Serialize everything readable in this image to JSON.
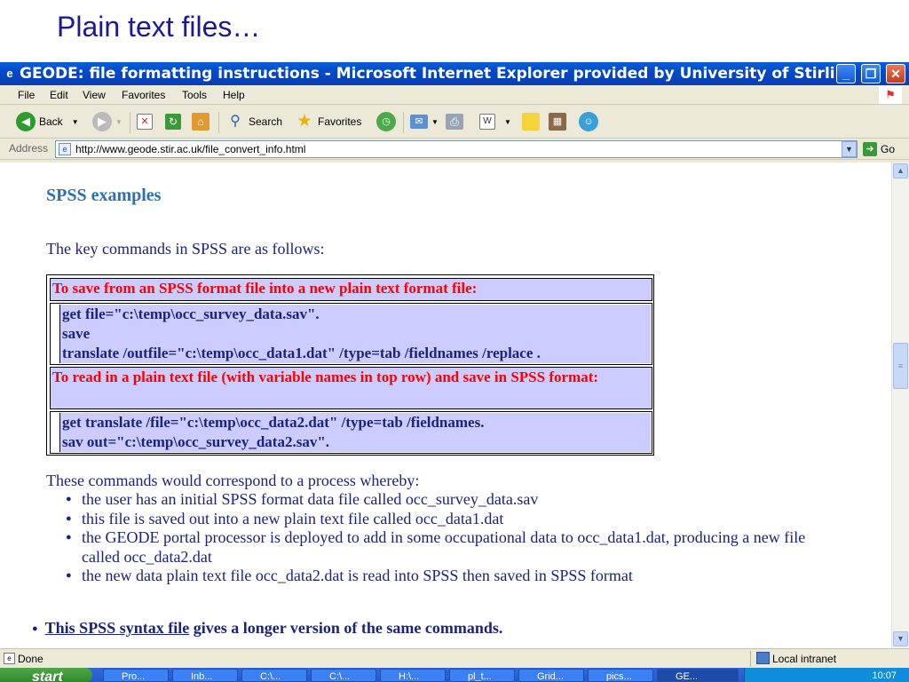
{
  "slide": {
    "title": "Plain text files…"
  },
  "window": {
    "title": "GEODE: file formatting instructions - Microsoft Internet Explorer provided by University of Stirling",
    "minimize": "_",
    "restore": "❐",
    "close": "✕"
  },
  "menu": [
    "File",
    "Edit",
    "View",
    "Favorites",
    "Tools",
    "Help"
  ],
  "toolbar": {
    "back": "Back",
    "search": "Search",
    "favorites": "Favorites"
  },
  "address": {
    "label": "Address",
    "url": "http://www.geode.stir.ac.uk/file_convert_info.html",
    "go": "Go"
  },
  "content": {
    "heading": "SPSS examples",
    "intro": "The key commands in SPSS are as follows:",
    "save_header": "To save from an SPSS format file into a new plain text format file:",
    "save_cmds": [
      "get file=\"c:\\temp\\occ_survey_data.sav\".",
      "save",
      "translate /outfile=\"c:\\temp\\occ_data1.dat\" /type=tab /fieldnames /replace ."
    ],
    "read_header": "To read in a plain text file (with variable names in top row) and save in SPSS format:",
    "read_cmds": [
      "get translate /file=\"c:\\temp\\occ_data2.dat\" /type=tab /fieldnames.",
      "sav out=\"c:\\temp\\occ_survey_data2.sav\"."
    ],
    "process_intro": "These commands would correspond to a process whereby:",
    "bullets": [
      "the user has an initial SPSS format data file called occ_survey_data.sav",
      "this file is saved out into a new plain text file called occ_data1.dat",
      "the GEODE portal processor is deployed to add in some occupational data to occ_data1.dat, producing a new file called occ_data2.dat",
      "the new data plain text file occ_data2.dat is read into SPSS then saved in SPSS format"
    ],
    "syntax_link": "This SPSS syntax file",
    "syntax_rest": " gives a longer version of the same commands."
  },
  "status": {
    "text": "Done",
    "zone": "Local intranet"
  },
  "taskbar": {
    "start": "start",
    "tasks": [
      "Pro...",
      "Inb...",
      "C:\\...",
      "C:\\...",
      "H:\\...",
      "pl_t...",
      "Grid...",
      "pics...",
      "GE..."
    ],
    "clock": "10:07"
  },
  "colors": {
    "heading": "#2a6fb8",
    "text": "#1a237e",
    "red": "#ff0000",
    "cell": "#ccccff"
  }
}
